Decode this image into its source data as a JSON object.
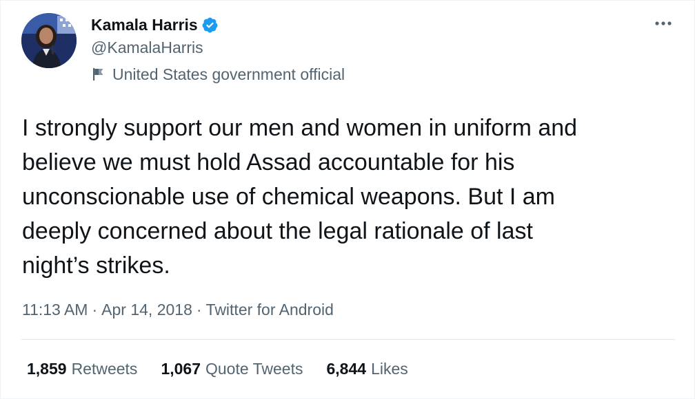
{
  "author": {
    "display_name": "Kamala Harris",
    "handle": "@KamalaHarris",
    "label": "United States government official",
    "verified": true
  },
  "tweet": {
    "text": "I strongly support our men and women in uniform and\nbelieve we must hold Assad accountable for his\nunconscionable use of chemical weapons. But I am\ndeeply concerned about the legal rationale of last\nnight’s strikes.",
    "time": "11:13 AM",
    "separator": "·",
    "date": "Apr 14, 2018",
    "source": "Twitter for Android"
  },
  "stats": {
    "retweets_count": "1,859",
    "retweets_label": "Retweets",
    "quotes_count": "1,067",
    "quotes_label": "Quote Tweets",
    "likes_count": "6,844",
    "likes_label": "Likes"
  },
  "icons": {
    "verified": "verified-badge-icon",
    "label": "flag-icon",
    "more": "more-horizontal-icon"
  },
  "colors": {
    "verified_blue": "#1d9bf0",
    "secondary_text": "#536471",
    "primary_text": "#0f1419"
  }
}
